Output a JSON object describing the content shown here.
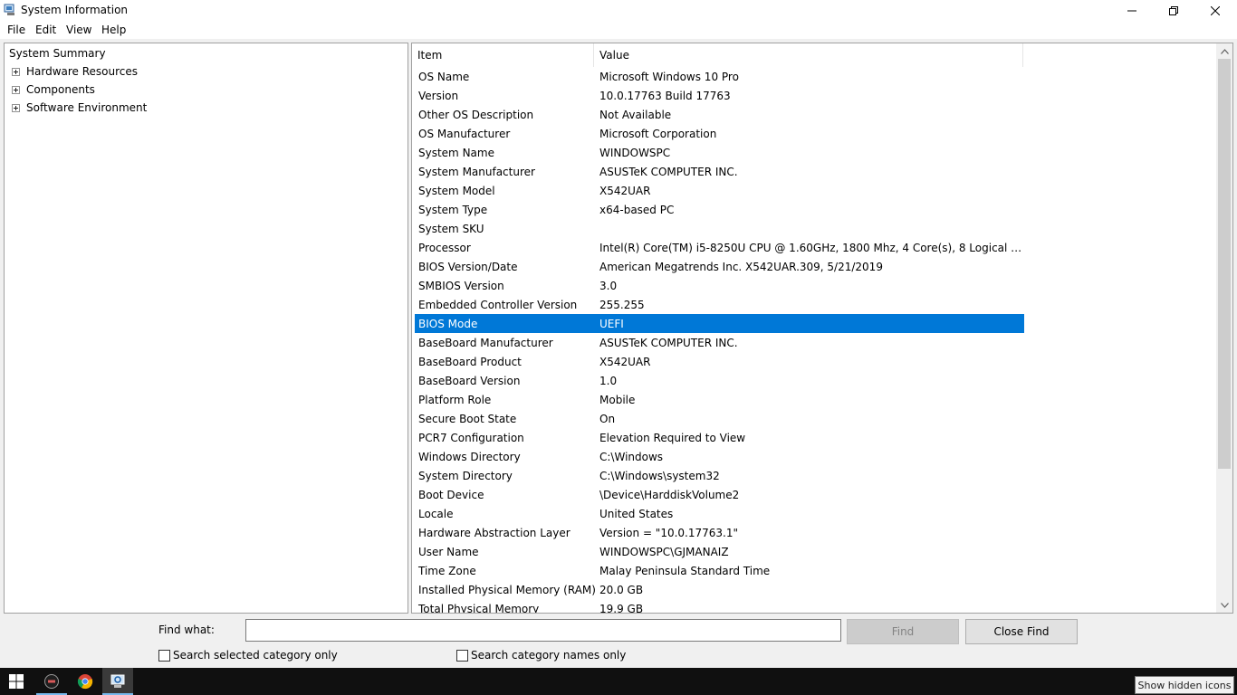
{
  "window": {
    "title": "System Information"
  },
  "menu": [
    "File",
    "Edit",
    "View",
    "Help"
  ],
  "tree": {
    "root": "System Summary",
    "children": [
      "Hardware Resources",
      "Components",
      "Software Environment"
    ]
  },
  "list": {
    "headers": {
      "item": "Item",
      "value": "Value"
    },
    "rows": [
      {
        "item": "OS Name",
        "value": "Microsoft Windows 10 Pro"
      },
      {
        "item": "Version",
        "value": "10.0.17763 Build 17763"
      },
      {
        "item": "Other OS Description",
        "value": "Not Available"
      },
      {
        "item": "OS Manufacturer",
        "value": "Microsoft Corporation"
      },
      {
        "item": "System Name",
        "value": "WINDOWSPC"
      },
      {
        "item": "System Manufacturer",
        "value": "ASUSTeK COMPUTER INC."
      },
      {
        "item": "System Model",
        "value": "X542UAR"
      },
      {
        "item": "System Type",
        "value": "x64-based PC"
      },
      {
        "item": "System SKU",
        "value": ""
      },
      {
        "item": "Processor",
        "value": "Intel(R) Core(TM) i5-8250U CPU @ 1.60GHz, 1800 Mhz, 4 Core(s), 8 Logical Pr..."
      },
      {
        "item": "BIOS Version/Date",
        "value": "American Megatrends Inc. X542UAR.309, 5/21/2019"
      },
      {
        "item": "SMBIOS Version",
        "value": "3.0"
      },
      {
        "item": "Embedded Controller Version",
        "value": "255.255"
      },
      {
        "item": "BIOS Mode",
        "value": "UEFI"
      },
      {
        "item": "BaseBoard Manufacturer",
        "value": "ASUSTeK COMPUTER INC."
      },
      {
        "item": "BaseBoard Product",
        "value": "X542UAR"
      },
      {
        "item": "BaseBoard Version",
        "value": "1.0"
      },
      {
        "item": "Platform Role",
        "value": "Mobile"
      },
      {
        "item": "Secure Boot State",
        "value": "On"
      },
      {
        "item": "PCR7 Configuration",
        "value": "Elevation Required to View"
      },
      {
        "item": "Windows Directory",
        "value": "C:\\Windows"
      },
      {
        "item": "System Directory",
        "value": "C:\\Windows\\system32"
      },
      {
        "item": "Boot Device",
        "value": "\\Device\\HarddiskVolume2"
      },
      {
        "item": "Locale",
        "value": "United States"
      },
      {
        "item": "Hardware Abstraction Layer",
        "value": "Version = \"10.0.17763.1\""
      },
      {
        "item": "User Name",
        "value": "WINDOWSPC\\GJMANAIZ"
      },
      {
        "item": "Time Zone",
        "value": "Malay Peninsula Standard Time"
      },
      {
        "item": "Installed Physical Memory (RAM)",
        "value": "20.0 GB"
      },
      {
        "item": "Total Physical Memory",
        "value": "19.9 GB"
      }
    ],
    "selected_item": "BIOS Mode"
  },
  "find": {
    "label": "Find what:",
    "value": "",
    "find_button": "Find",
    "close_button": "Close Find",
    "check_selected": "Search selected category only",
    "check_names": "Search category names only"
  },
  "taskbar": {
    "icons": [
      "windows-start-icon",
      "app-icon",
      "chrome-icon",
      "system-information-icon"
    ],
    "tooltip": "Show hidden icons"
  },
  "colors": {
    "selection": "#0078d7",
    "taskbar": "#101010"
  }
}
